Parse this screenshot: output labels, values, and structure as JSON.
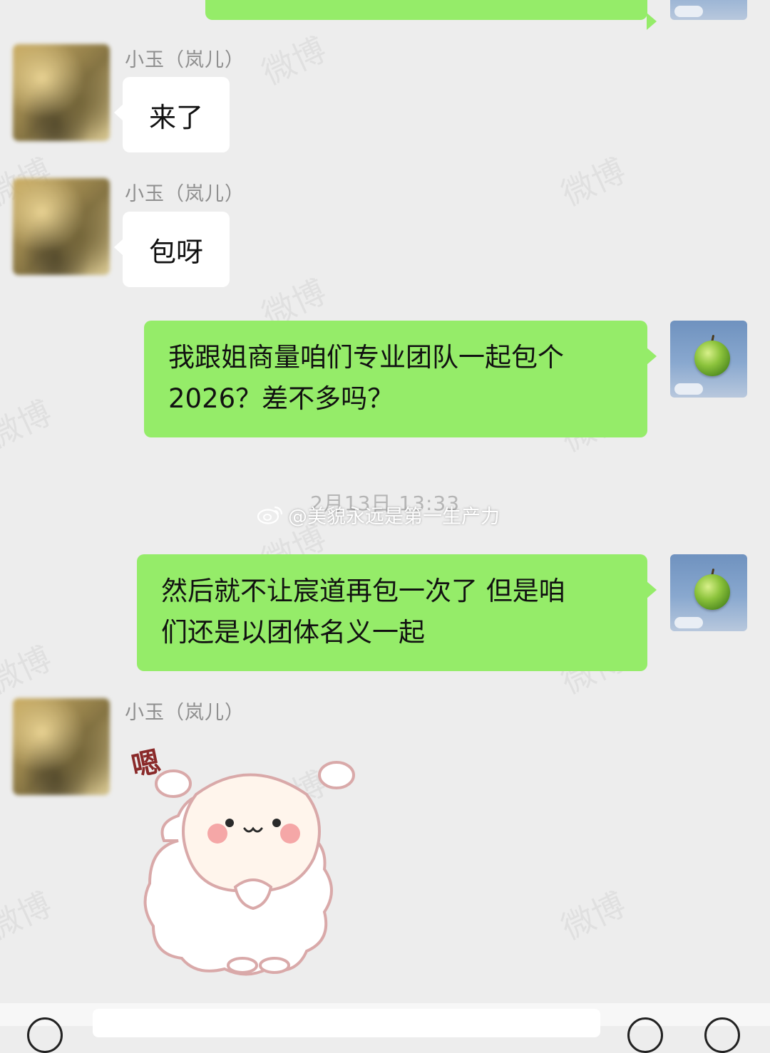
{
  "chat": {
    "sender_name": "小玉（岚儿）",
    "messages": [
      {
        "from": "other",
        "text": "来了"
      },
      {
        "from": "other",
        "text": "包呀"
      },
      {
        "from": "me",
        "lines": [
          "我跟姐商量咱们专业团队一起包个",
          "2026？差不多吗？"
        ]
      },
      {
        "from": "me",
        "lines": [
          "然后就不让宸道再包一次了 但是咱",
          "们还是以团体名义一起"
        ]
      },
      {
        "from": "other",
        "sticker": "sheep-sticker",
        "sticker_text": "嗯"
      }
    ],
    "timestamp": "2月13日 13:33"
  },
  "overlay": {
    "credit": "@美貌永远是第一生产力",
    "watermark_text": "微博"
  },
  "icons": {
    "my_avatar": "green-apple-avatar",
    "other_avatar": "blurred-avatar",
    "voice_button": "voice-icon",
    "emoji_button": "emoji-icon",
    "plus_button": "plus-icon"
  },
  "colors": {
    "background": "#ededed",
    "my_bubble": "#95ec69",
    "other_bubble": "#ffffff",
    "name_text": "#8f8f8f"
  }
}
